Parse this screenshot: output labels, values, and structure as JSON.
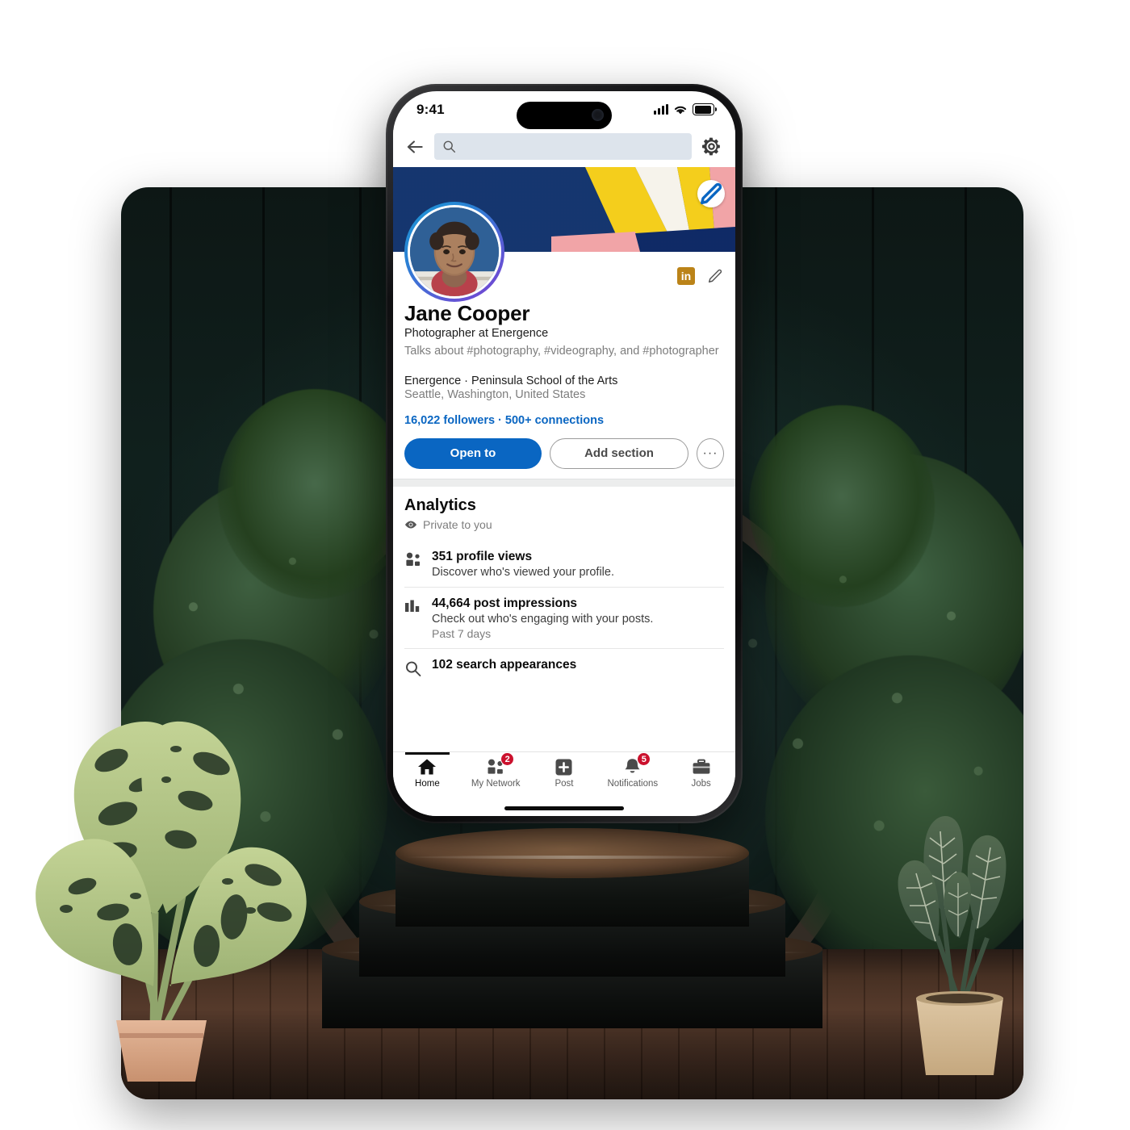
{
  "scene": {
    "description": "LinkedIn mobile profile mockup on a smartphone standing on a dark three-tier podium in a botanical studio set",
    "background_colors": {
      "wall": "#101c1a",
      "deck": "#6b4631",
      "foliage": "#2d4a32",
      "podium": "#141615",
      "podium_top": "#7a5738"
    },
    "plants": {
      "left": {
        "name": "monstera-plant",
        "leaf_color": "#b6c98b",
        "pot_color": "#d8a98c"
      },
      "right": {
        "name": "anthurium-plant",
        "leaf_color": "#4a6450",
        "pot_color": "#d6bb97"
      }
    }
  },
  "phone": {
    "status_bar": {
      "time": "9:41",
      "icons": [
        "cellular-signal-icon",
        "wifi-icon",
        "battery-icon"
      ]
    },
    "home_indicator": true
  },
  "topnav": {
    "back_icon": "back-arrow-icon",
    "search": {
      "value": "",
      "placeholder": "",
      "icon": "search-icon"
    },
    "settings_icon": "gear-icon"
  },
  "cover": {
    "edit_icon": "pencil-edit-icon",
    "colors": [
      "#16357a",
      "#1b4b8f",
      "#f5cf1c",
      "#f7f4ec",
      "#f2a5a8",
      "#0f2a66"
    ]
  },
  "profile": {
    "avatar_name": "profile-photo",
    "premium_badge": "in",
    "edit_icon": "pencil-edit-icon",
    "name": "Jane Cooper",
    "headline": "Photographer at Energence",
    "talks_about": "Talks about #photography, #videography, and #photographer",
    "company_education": "Energence · Peninsula School of the Arts",
    "location": "Seattle, Washington, United States",
    "stats": "16,022 followers · 500+ connections",
    "accent_color": "#0a66c2",
    "buttons": {
      "open_to": "Open to",
      "add_section": "Add section",
      "more": "···"
    }
  },
  "analytics": {
    "title": "Analytics",
    "privacy": "Private to you",
    "privacy_icon": "eye-icon",
    "items": [
      {
        "icon": "people-icon",
        "headline": "351 profile views",
        "sub": "Discover who's viewed your profile.",
        "meta": ""
      },
      {
        "icon": "bar-chart-icon",
        "headline": "44,664 post impressions",
        "sub": "Check out who's engaging with your posts.",
        "meta": "Past 7 days"
      },
      {
        "icon": "search-icon",
        "headline": "102 search appearances",
        "sub": "",
        "meta": ""
      }
    ]
  },
  "bottomnav": {
    "items": [
      {
        "label": "Home",
        "icon": "home-icon",
        "badge": "",
        "active": true
      },
      {
        "label": "My Network",
        "icon": "people-icon",
        "badge": "2",
        "active": false
      },
      {
        "label": "Post",
        "icon": "plus-square-icon",
        "badge": "",
        "active": false
      },
      {
        "label": "Notifications",
        "icon": "bell-icon",
        "badge": "5",
        "active": false
      },
      {
        "label": "Jobs",
        "icon": "briefcase-icon",
        "badge": "",
        "active": false
      }
    ],
    "badge_color": "#cb112d"
  }
}
